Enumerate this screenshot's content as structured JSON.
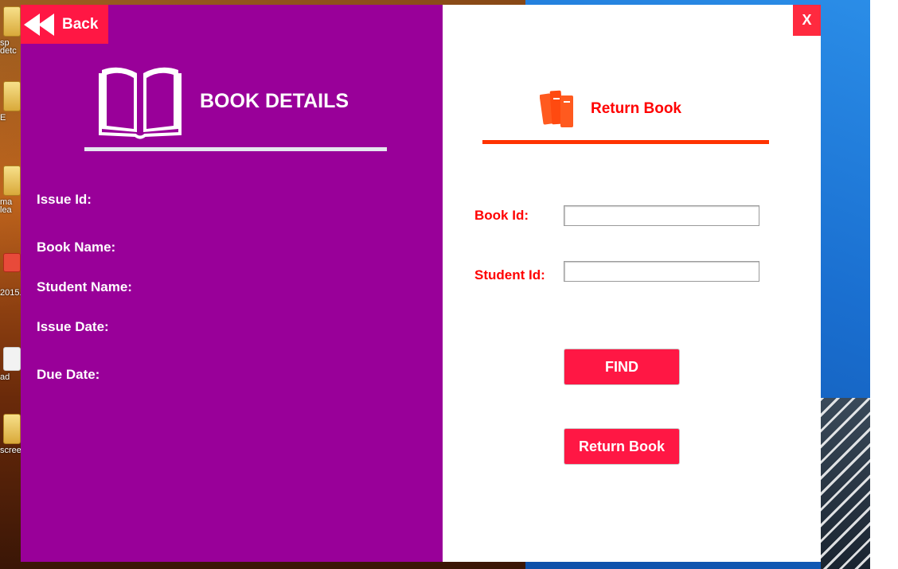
{
  "colors": {
    "left_panel": "#990099",
    "accent": "#ff1744",
    "close": "#ff2a3f",
    "rule_orange": "#ff3300",
    "label_red": "#ff0000"
  },
  "desktop_icons": [
    {
      "label": "sp",
      "icon": "folder-icon"
    },
    {
      "label": "detc",
      "icon": "folder-icon"
    },
    {
      "label": "E",
      "icon": "folder-icon"
    },
    {
      "label": "ma",
      "icon": "folder-icon"
    },
    {
      "label": "lea",
      "icon": "folder-icon"
    },
    {
      "label": "2015.",
      "icon": "music-file-icon"
    },
    {
      "label": "ad",
      "icon": "document-icon"
    },
    {
      "label": "scree",
      "icon": "folder-icon"
    }
  ],
  "window": {
    "back_label": "Back",
    "close_label": "X",
    "left": {
      "title": "BOOK DETAILS",
      "fields": {
        "issue_id": "Issue Id:",
        "book_name": "Book Name:",
        "student_name": "Student Name:",
        "issue_date": "Issue Date:",
        "due_date": "Due Date:"
      }
    },
    "right": {
      "title": "Return Book",
      "book_id_label": "Book Id:",
      "book_id_value": "",
      "student_id_label": "Student Id:",
      "student_id_value": "",
      "find_label": "FIND",
      "return_label": "Return Book"
    }
  }
}
